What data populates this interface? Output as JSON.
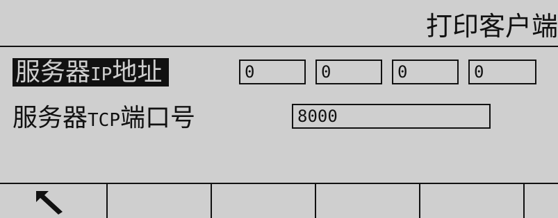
{
  "screen": {
    "title": "打印客户端"
  },
  "form": {
    "server_ip_label_cn": "服务器",
    "server_ip_label_latin": "IP",
    "server_ip_label_cn2": "地址",
    "server_ip_octets": [
      "0",
      "0",
      "0",
      "0"
    ],
    "server_tcp_label_cn": "服务器",
    "server_tcp_label_latin": "TCP",
    "server_tcp_label_cn2": "端口号",
    "server_tcp_port": "8000"
  },
  "softkeys": {
    "keys": [
      {
        "icon": "exit-arrow-icon"
      },
      {
        "icon": ""
      },
      {
        "icon": ""
      },
      {
        "icon": ""
      },
      {
        "icon": ""
      },
      {
        "icon": ""
      }
    ]
  }
}
